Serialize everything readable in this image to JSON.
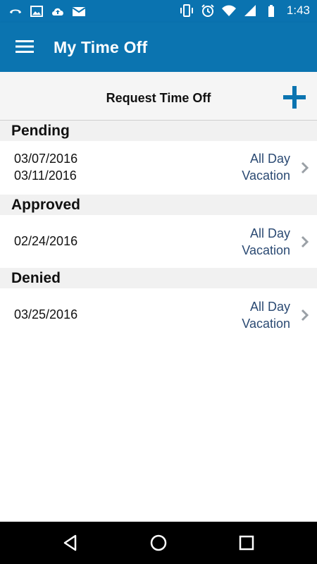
{
  "status_bar": {
    "time": "1:43",
    "left_icons": [
      "phone-handset-icon",
      "image-icon",
      "cloud-upload-icon",
      "mail-icon"
    ],
    "right_icons": [
      "vibrate-icon",
      "alarm-icon",
      "wifi-icon",
      "signal-icon",
      "battery-icon"
    ]
  },
  "app_bar": {
    "title": "My Time Off",
    "menu_icon": "hamburger-menu-icon",
    "color": "#0b74b0"
  },
  "request": {
    "label": "Request Time Off",
    "add_icon": "plus-icon",
    "accent": "#0b74b0"
  },
  "sections": [
    {
      "title": "Pending",
      "items": [
        {
          "start": "03/07/2016",
          "end": "03/11/2016",
          "type_line1": "All Day",
          "type_line2": "Vacation"
        }
      ]
    },
    {
      "title": "Approved",
      "items": [
        {
          "start": "02/24/2016",
          "type_line1": "All Day",
          "type_line2": "Vacation"
        }
      ]
    },
    {
      "title": "Denied",
      "items": [
        {
          "start": "03/25/2016",
          "type_line1": "All Day",
          "type_line2": "Vacation"
        }
      ]
    }
  ],
  "nav_bar": {
    "buttons": [
      "back-triangle-icon",
      "home-circle-icon",
      "recents-square-icon"
    ]
  }
}
